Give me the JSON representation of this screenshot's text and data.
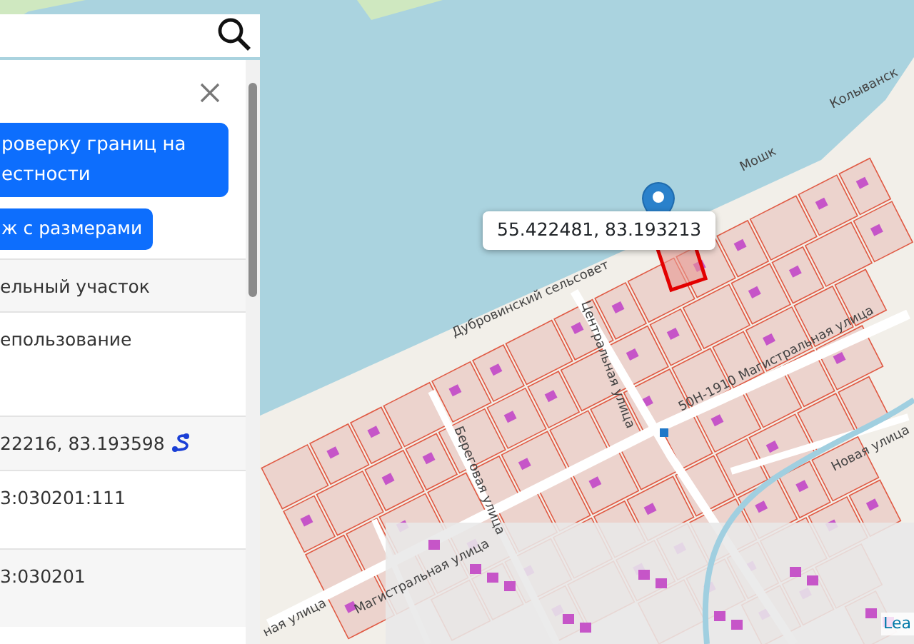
{
  "panel": {
    "buttons": [
      {
        "label": "роверку границ на естности",
        "kind": "wide"
      },
      {
        "label": "ж с размерами",
        "kind": "small"
      }
    ],
    "rows": [
      {
        "text": "ельный участок",
        "kind": "text"
      },
      {
        "text": "епользование",
        "kind": "text"
      },
      {
        "text": "22216, 83.193598",
        "kind": "coordinates"
      },
      {
        "text": "3:030201:111",
        "kind": "text"
      },
      {
        "text": "3:030201",
        "kind": "text"
      }
    ]
  },
  "map": {
    "popup": "55.422481, 83.193213",
    "labels": [
      {
        "text": "Колыванск"
      },
      {
        "text": "Мошк"
      },
      {
        "text": "Дубровинский сельсовет"
      },
      {
        "text": "Центральная улица"
      },
      {
        "text": "50Н-1910  Магистральная улица"
      },
      {
        "text": "Береговая улица"
      },
      {
        "text": "Магистральная улица"
      },
      {
        "text": "Новая улица"
      },
      {
        "text": "ная улица"
      }
    ],
    "attribution": "Lea"
  }
}
